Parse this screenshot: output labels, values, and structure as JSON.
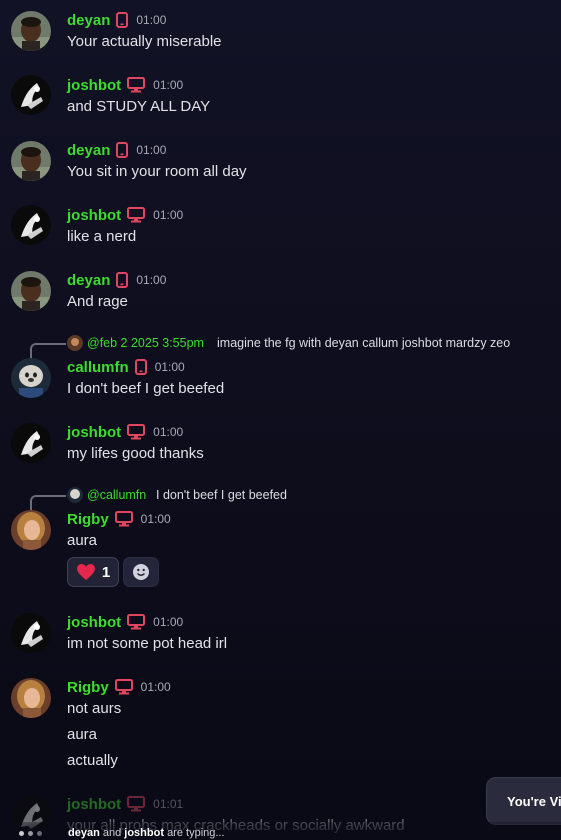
{
  "colors": {
    "username": "#3ddc2f",
    "device_icon": "#e0475e",
    "text": "#e1e2e6"
  },
  "messages": [
    {
      "user": "deyan",
      "device": "mobile-icon",
      "time": "01:00",
      "lines": [
        "Your actually miserable"
      ]
    },
    {
      "user": "joshbot",
      "device": "desktop-icon",
      "time": "01:00",
      "lines": [
        "and STUDY ALL DAY"
      ]
    },
    {
      "user": "deyan",
      "device": "mobile-icon",
      "time": "01:00",
      "lines": [
        "You sit in your room all day"
      ]
    },
    {
      "user": "joshbot",
      "device": "desktop-icon",
      "time": "01:00",
      "lines": [
        "like a nerd"
      ]
    },
    {
      "user": "deyan",
      "device": "mobile-icon",
      "time": "01:00",
      "lines": [
        "And rage"
      ]
    },
    {
      "user": "callumfn",
      "device": "mobile-icon",
      "time": "01:00",
      "lines": [
        "I don't beef I get beefed"
      ],
      "reply": {
        "mention": "@feb 2 2025 3:55pm",
        "quote": "imagine the fg with deyan callum joshbot mardzy zeo"
      }
    },
    {
      "user": "joshbot",
      "device": "desktop-icon",
      "time": "01:00",
      "lines": [
        "my lifes good thanks"
      ]
    },
    {
      "user": "Rigby",
      "device": "desktop-icon",
      "time": "01:00",
      "lines": [
        "aura"
      ],
      "reply": {
        "mention": "@callumfn",
        "quote": "I don't beef I get beefed"
      },
      "reaction": {
        "emoji": "heart-icon",
        "count": "1"
      }
    },
    {
      "user": "joshbot",
      "device": "desktop-icon",
      "time": "01:00",
      "lines": [
        "im not some pot head irl"
      ]
    },
    {
      "user": "Rigby",
      "device": "desktop-icon",
      "time": "01:00",
      "lines": [
        "not aurs",
        "aura",
        "actually"
      ]
    },
    {
      "user": "joshbot",
      "device": "desktop-icon",
      "time": "01:01",
      "lines": [
        "your all probs max crackheads or socially awkward"
      ]
    }
  ],
  "toast": {
    "label": "You're Vie"
  },
  "typing": {
    "user1": "deyan",
    "joiner": "and",
    "user2": "joshbot",
    "suffix": "are typing..."
  }
}
